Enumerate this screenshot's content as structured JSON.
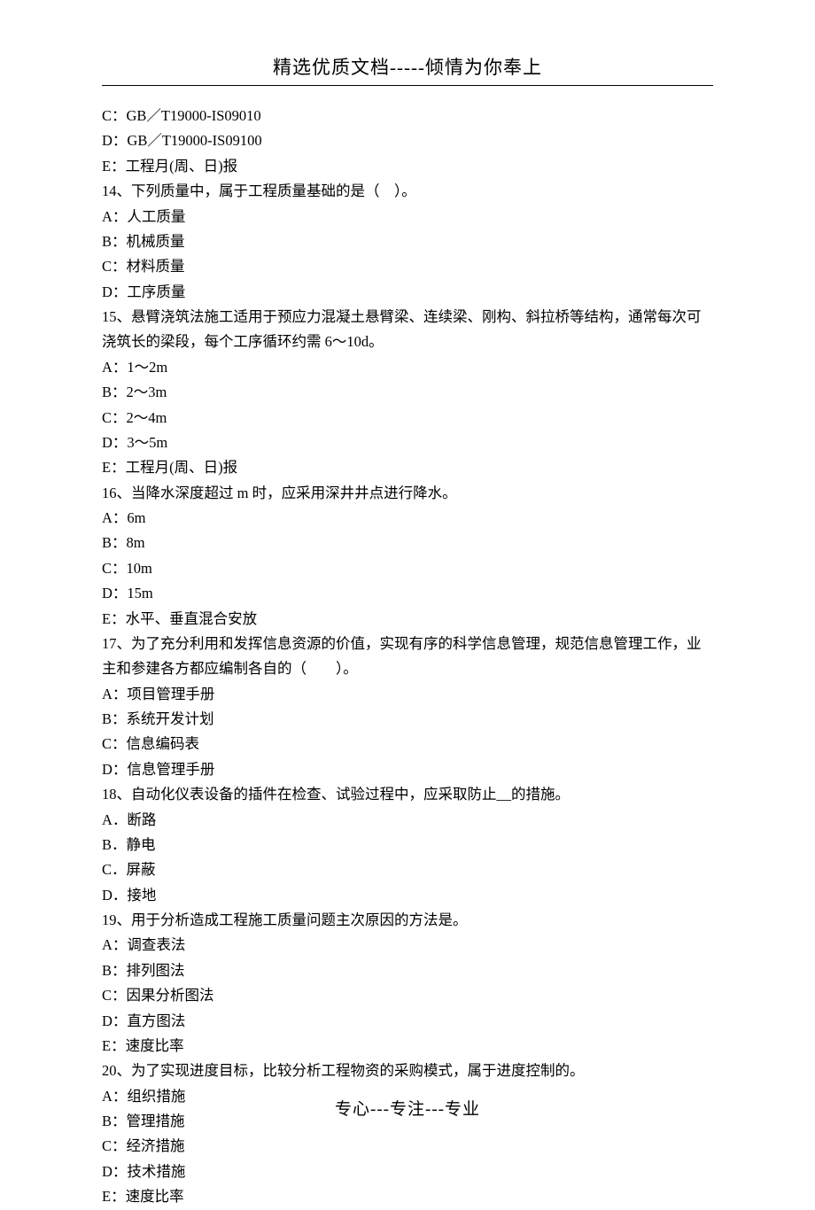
{
  "header": "精选优质文档-----倾情为你奉上",
  "footer": "专心---专注---专业",
  "lines": {
    "l0": "C：GB／T19000-IS09010",
    "l1": "D：GB／T19000-IS09100",
    "l2": "E：工程月(周、日)报",
    "l3": "14、下列质量中，属于工程质量基础的是（　）。",
    "l4": "A：人工质量",
    "l5": "B：机械质量",
    "l6": "C：材料质量",
    "l7": "D：工序质量",
    "l8": "15、悬臂浇筑法施工适用于预应力混凝土悬臂梁、连续梁、刚构、斜拉桥等结构，通常每次可浇筑长的梁段，每个工序循环约需 6～10d。",
    "l9": "A：1～2m",
    "l10": "B：2～3m",
    "l11": "C：2～4m",
    "l12": "D：3～5m",
    "l13": "E：工程月(周、日)报",
    "l14": "16、当降水深度超过 m 时，应采用深井井点进行降水。",
    "l15": "A：6m",
    "l16": "B：8m",
    "l17": "C：10m",
    "l18": "D：15m",
    "l19": "E：水平、垂直混合安放",
    "l20": "17、为了充分利用和发挥信息资源的价值，实现有序的科学信息管理，规范信息管理工作，业主和参建各方都应编制各自的（　　）。",
    "l21": "A：项目管理手册",
    "l22": "B：系统开发计划",
    "l23": "C：信息编码表",
    "l24": "D：信息管理手册",
    "l25": "18、自动化仪表设备的插件在检查、试验过程中，应采取防止__的措施。",
    "l26": "A．断路",
    "l27": "B．静电",
    "l28": "C．屏蔽",
    "l29": "D．接地",
    "l30": "19、用于分析造成工程施工质量问题主次原因的方法是。",
    "l31": "A：调查表法",
    "l32": "B：排列图法",
    "l33": "C：因果分析图法",
    "l34": "D：直方图法",
    "l35": "E：速度比率",
    "l36": "20、为了实现进度目标，比较分析工程物资的采购模式，属于进度控制的。",
    "l37": "A：组织措施",
    "l38": "B：管理措施",
    "l39": "C：经济措施",
    "l40": "D：技术措施",
    "l41": "E：速度比率"
  }
}
